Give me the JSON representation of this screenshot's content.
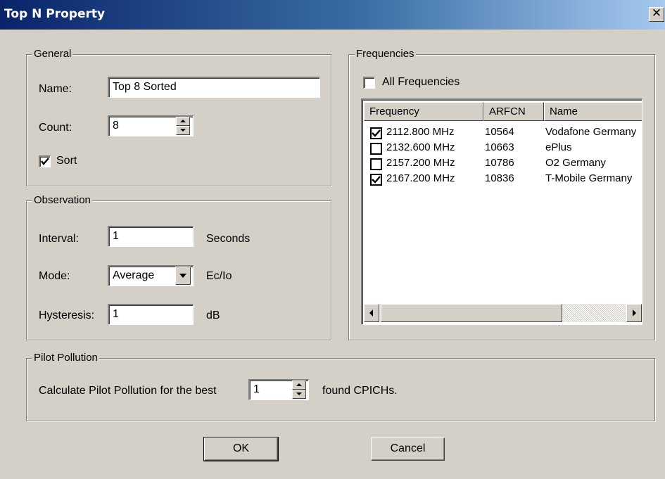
{
  "window": {
    "title": "Top N Property",
    "close_glyph": "✕"
  },
  "general": {
    "legend": "General",
    "name_label": "Name:",
    "name_value": "Top 8 Sorted",
    "count_label": "Count:",
    "count_value": "8",
    "sort_label": "Sort",
    "sort_checked": true
  },
  "observation": {
    "legend": "Observation",
    "interval_label": "Interval:",
    "interval_value": "1",
    "interval_unit": "Seconds",
    "mode_label": "Mode:",
    "mode_value": "Average",
    "mode_unit": "Ec/Io",
    "hysteresis_label": "Hysteresis:",
    "hysteresis_value": "1",
    "hysteresis_unit": "dB"
  },
  "frequencies": {
    "legend": "Frequencies",
    "all_label": "All Frequencies",
    "all_checked": false,
    "columns": [
      "Frequency",
      "ARFCN",
      "Name"
    ],
    "rows": [
      {
        "checked": true,
        "frequency": "2112.800 MHz",
        "arfcn": "10564",
        "name": "Vodafone Germany"
      },
      {
        "checked": false,
        "frequency": "2132.600 MHz",
        "arfcn": "10663",
        "name": "ePlus"
      },
      {
        "checked": false,
        "frequency": "2157.200 MHz",
        "arfcn": "10786",
        "name": "O2 Germany"
      },
      {
        "checked": true,
        "frequency": "2167.200 MHz",
        "arfcn": "10836",
        "name": "T-Mobile Germany"
      }
    ]
  },
  "pilot_pollution": {
    "legend": "Pilot Pollution",
    "text_before": "Calculate Pilot Pollution for the best",
    "value": "1",
    "text_after": "found CPICHs."
  },
  "buttons": {
    "ok": "OK",
    "cancel": "Cancel"
  },
  "icons": [
    "close-icon",
    "spin-up-icon",
    "spin-down-icon",
    "dropdown-arrow-icon",
    "scroll-left-icon",
    "scroll-right-icon",
    "checkmark-icon"
  ]
}
